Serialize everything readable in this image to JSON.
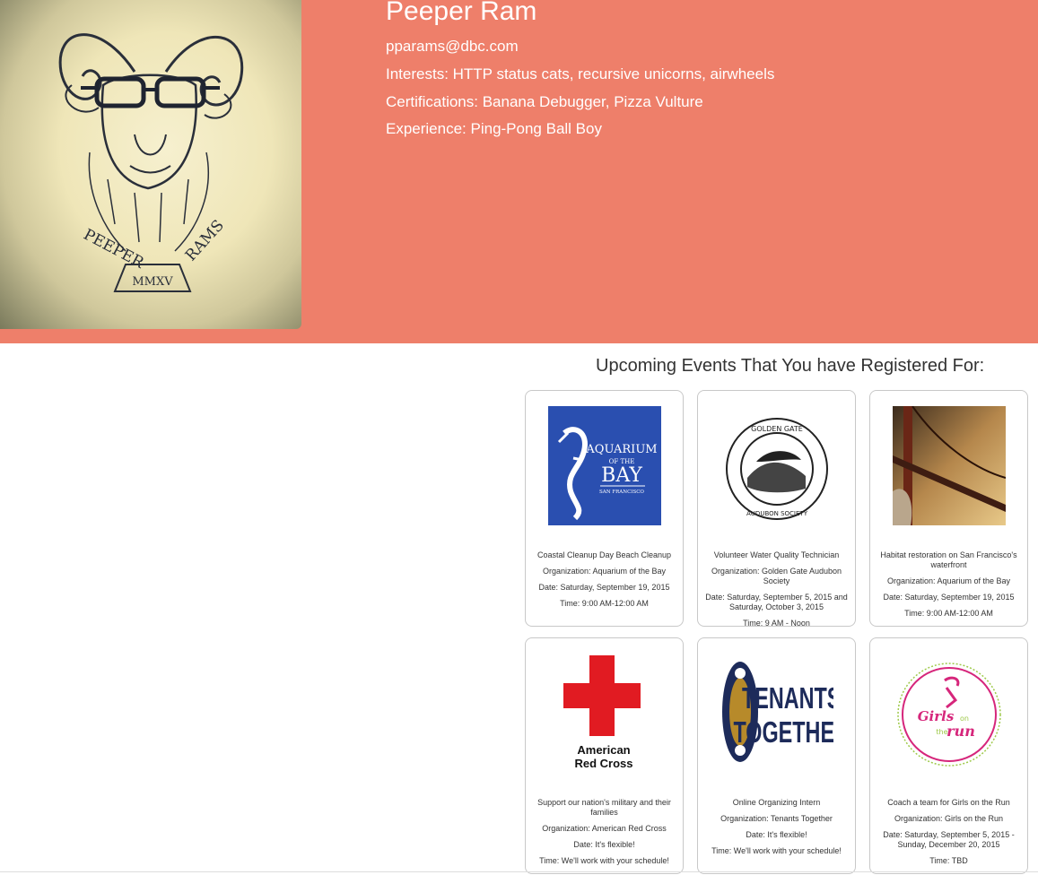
{
  "profile": {
    "name": "Peeper Ram",
    "email": "pparams@dbc.com",
    "interests": "Interests: HTTP status cats, recursive unicorns, airwheels",
    "certifications": "Certifications: Banana Debugger, Pizza Vulture",
    "experience": "Experience: Ping-Pong Ball Boy",
    "avatar_text": [
      "PEEPER",
      "RAMS",
      "MMXV"
    ]
  },
  "events_title": "Upcoming Events That You have Registered For:",
  "events": [
    {
      "title": "Coastal Cleanup Day Beach Cleanup",
      "organization": "Organization: Aquarium of the Bay",
      "date": "Date: Saturday, September 19, 2015",
      "time": "Time: 9:00 AM-12:00 AM",
      "logo": "aquarium-of-the-bay-logo",
      "logo_text": [
        "AQUARIUM",
        "OF THE",
        "BAY",
        "SAN FRANCISCO"
      ]
    },
    {
      "title": "Volunteer Water Quality Technician",
      "organization": "Organization: Golden Gate Audubon Society",
      "date": "Date: Saturday, September 5, 2015 and Saturday, October 3, 2015",
      "time": "Time: 9 AM - Noon",
      "logo": "golden-gate-audubon-logo",
      "logo_text": [
        "GOLDEN GATE",
        "AUDUBON SOCIETY"
      ]
    },
    {
      "title": "Habitat restoration on San Francisco's waterfront",
      "organization": "Organization: Aquarium of the Bay",
      "date": "Date: Saturday, September 19, 2015",
      "time": "Time: 9:00 AM-12:00 AM",
      "logo": "golden-gate-bridge-photo"
    },
    {
      "title": "Support our nation's military and their families",
      "organization": "Organization: American Red Cross",
      "date": "Date: It's flexible!",
      "time": "Time: We'll work with your schedule!",
      "logo": "american-red-cross-logo",
      "logo_text": [
        "American",
        "Red Cross"
      ]
    },
    {
      "title": "Online Organizing Intern",
      "organization": "Organization: Tenants Together",
      "date": "Date: It's flexible!",
      "time": "Time: We'll work with your schedule!",
      "logo": "tenants-together-logo",
      "logo_text": [
        "TENANTS",
        "TOGETHER"
      ]
    },
    {
      "title": "Coach a team for Girls on the Run",
      "organization": "Organization: Girls on the Run",
      "date": "Date: Saturday, September 5, 2015 - Sunday, December 20, 2015",
      "time": "Time: TBD",
      "logo": "girls-on-the-run-logo",
      "logo_text": [
        "Girls",
        "on",
        "the",
        "run"
      ]
    }
  ],
  "colors": {
    "header_bg": "#ee7f6a",
    "aquarium_blue": "#2a4fb0",
    "red_cross": "#e11b22",
    "tenants_navy": "#1d2b5a",
    "tenants_gold": "#b78a2a",
    "girls_pink": "#d6267b"
  }
}
